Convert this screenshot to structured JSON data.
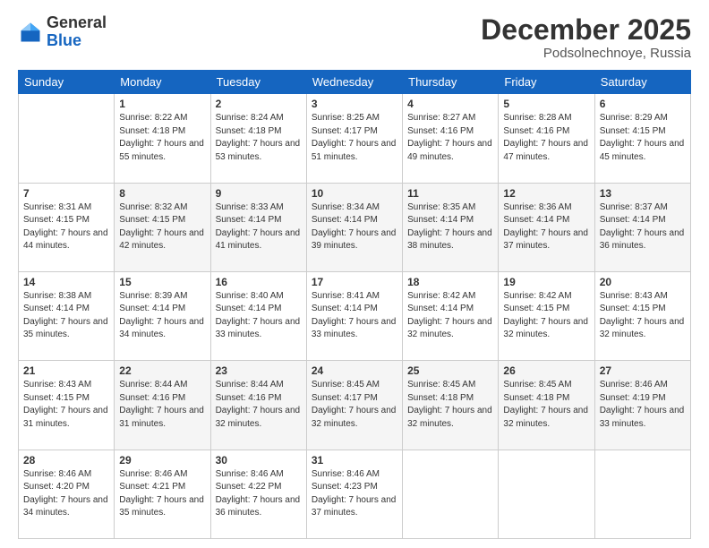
{
  "header": {
    "logo_general": "General",
    "logo_blue": "Blue",
    "month_title": "December 2025",
    "location": "Podsolnechnoye, Russia"
  },
  "days_of_week": [
    "Sunday",
    "Monday",
    "Tuesday",
    "Wednesday",
    "Thursday",
    "Friday",
    "Saturday"
  ],
  "weeks": [
    [
      {
        "day": "",
        "sunrise": "",
        "sunset": "",
        "daylight": ""
      },
      {
        "day": "1",
        "sunrise": "Sunrise: 8:22 AM",
        "sunset": "Sunset: 4:18 PM",
        "daylight": "Daylight: 7 hours and 55 minutes."
      },
      {
        "day": "2",
        "sunrise": "Sunrise: 8:24 AM",
        "sunset": "Sunset: 4:18 PM",
        "daylight": "Daylight: 7 hours and 53 minutes."
      },
      {
        "day": "3",
        "sunrise": "Sunrise: 8:25 AM",
        "sunset": "Sunset: 4:17 PM",
        "daylight": "Daylight: 7 hours and 51 minutes."
      },
      {
        "day": "4",
        "sunrise": "Sunrise: 8:27 AM",
        "sunset": "Sunset: 4:16 PM",
        "daylight": "Daylight: 7 hours and 49 minutes."
      },
      {
        "day": "5",
        "sunrise": "Sunrise: 8:28 AM",
        "sunset": "Sunset: 4:16 PM",
        "daylight": "Daylight: 7 hours and 47 minutes."
      },
      {
        "day": "6",
        "sunrise": "Sunrise: 8:29 AM",
        "sunset": "Sunset: 4:15 PM",
        "daylight": "Daylight: 7 hours and 45 minutes."
      }
    ],
    [
      {
        "day": "7",
        "sunrise": "Sunrise: 8:31 AM",
        "sunset": "Sunset: 4:15 PM",
        "daylight": "Daylight: 7 hours and 44 minutes."
      },
      {
        "day": "8",
        "sunrise": "Sunrise: 8:32 AM",
        "sunset": "Sunset: 4:15 PM",
        "daylight": "Daylight: 7 hours and 42 minutes."
      },
      {
        "day": "9",
        "sunrise": "Sunrise: 8:33 AM",
        "sunset": "Sunset: 4:14 PM",
        "daylight": "Daylight: 7 hours and 41 minutes."
      },
      {
        "day": "10",
        "sunrise": "Sunrise: 8:34 AM",
        "sunset": "Sunset: 4:14 PM",
        "daylight": "Daylight: 7 hours and 39 minutes."
      },
      {
        "day": "11",
        "sunrise": "Sunrise: 8:35 AM",
        "sunset": "Sunset: 4:14 PM",
        "daylight": "Daylight: 7 hours and 38 minutes."
      },
      {
        "day": "12",
        "sunrise": "Sunrise: 8:36 AM",
        "sunset": "Sunset: 4:14 PM",
        "daylight": "Daylight: 7 hours and 37 minutes."
      },
      {
        "day": "13",
        "sunrise": "Sunrise: 8:37 AM",
        "sunset": "Sunset: 4:14 PM",
        "daylight": "Daylight: 7 hours and 36 minutes."
      }
    ],
    [
      {
        "day": "14",
        "sunrise": "Sunrise: 8:38 AM",
        "sunset": "Sunset: 4:14 PM",
        "daylight": "Daylight: 7 hours and 35 minutes."
      },
      {
        "day": "15",
        "sunrise": "Sunrise: 8:39 AM",
        "sunset": "Sunset: 4:14 PM",
        "daylight": "Daylight: 7 hours and 34 minutes."
      },
      {
        "day": "16",
        "sunrise": "Sunrise: 8:40 AM",
        "sunset": "Sunset: 4:14 PM",
        "daylight": "Daylight: 7 hours and 33 minutes."
      },
      {
        "day": "17",
        "sunrise": "Sunrise: 8:41 AM",
        "sunset": "Sunset: 4:14 PM",
        "daylight": "Daylight: 7 hours and 33 minutes."
      },
      {
        "day": "18",
        "sunrise": "Sunrise: 8:42 AM",
        "sunset": "Sunset: 4:14 PM",
        "daylight": "Daylight: 7 hours and 32 minutes."
      },
      {
        "day": "19",
        "sunrise": "Sunrise: 8:42 AM",
        "sunset": "Sunset: 4:15 PM",
        "daylight": "Daylight: 7 hours and 32 minutes."
      },
      {
        "day": "20",
        "sunrise": "Sunrise: 8:43 AM",
        "sunset": "Sunset: 4:15 PM",
        "daylight": "Daylight: 7 hours and 32 minutes."
      }
    ],
    [
      {
        "day": "21",
        "sunrise": "Sunrise: 8:43 AM",
        "sunset": "Sunset: 4:15 PM",
        "daylight": "Daylight: 7 hours and 31 minutes."
      },
      {
        "day": "22",
        "sunrise": "Sunrise: 8:44 AM",
        "sunset": "Sunset: 4:16 PM",
        "daylight": "Daylight: 7 hours and 31 minutes."
      },
      {
        "day": "23",
        "sunrise": "Sunrise: 8:44 AM",
        "sunset": "Sunset: 4:16 PM",
        "daylight": "Daylight: 7 hours and 32 minutes."
      },
      {
        "day": "24",
        "sunrise": "Sunrise: 8:45 AM",
        "sunset": "Sunset: 4:17 PM",
        "daylight": "Daylight: 7 hours and 32 minutes."
      },
      {
        "day": "25",
        "sunrise": "Sunrise: 8:45 AM",
        "sunset": "Sunset: 4:18 PM",
        "daylight": "Daylight: 7 hours and 32 minutes."
      },
      {
        "day": "26",
        "sunrise": "Sunrise: 8:45 AM",
        "sunset": "Sunset: 4:18 PM",
        "daylight": "Daylight: 7 hours and 32 minutes."
      },
      {
        "day": "27",
        "sunrise": "Sunrise: 8:46 AM",
        "sunset": "Sunset: 4:19 PM",
        "daylight": "Daylight: 7 hours and 33 minutes."
      }
    ],
    [
      {
        "day": "28",
        "sunrise": "Sunrise: 8:46 AM",
        "sunset": "Sunset: 4:20 PM",
        "daylight": "Daylight: 7 hours and 34 minutes."
      },
      {
        "day": "29",
        "sunrise": "Sunrise: 8:46 AM",
        "sunset": "Sunset: 4:21 PM",
        "daylight": "Daylight: 7 hours and 35 minutes."
      },
      {
        "day": "30",
        "sunrise": "Sunrise: 8:46 AM",
        "sunset": "Sunset: 4:22 PM",
        "daylight": "Daylight: 7 hours and 36 minutes."
      },
      {
        "day": "31",
        "sunrise": "Sunrise: 8:46 AM",
        "sunset": "Sunset: 4:23 PM",
        "daylight": "Daylight: 7 hours and 37 minutes."
      },
      {
        "day": "",
        "sunrise": "",
        "sunset": "",
        "daylight": ""
      },
      {
        "day": "",
        "sunrise": "",
        "sunset": "",
        "daylight": ""
      },
      {
        "day": "",
        "sunrise": "",
        "sunset": "",
        "daylight": ""
      }
    ]
  ]
}
